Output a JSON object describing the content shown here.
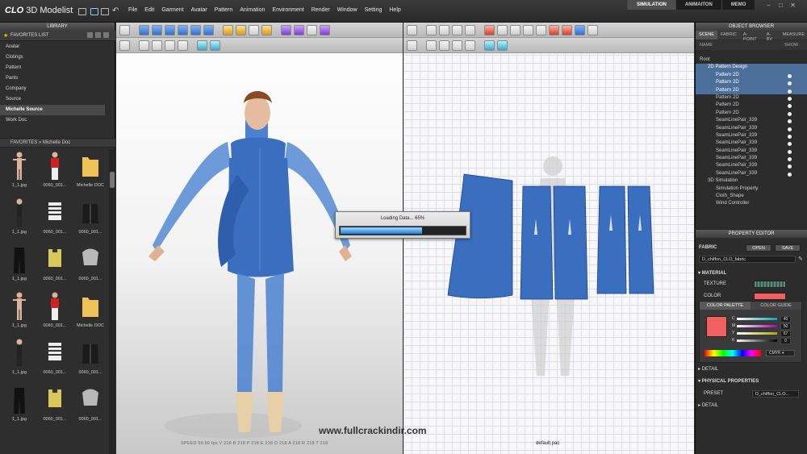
{
  "app": {
    "brand": "CLO",
    "name": "3D Modelist"
  },
  "menu": [
    "File",
    "Edit",
    "Garment",
    "Avatar",
    "Pattern",
    "Animation",
    "Environment",
    "Render",
    "Window",
    "Setting",
    "Help"
  ],
  "modes": [
    {
      "label": "SIMULATION",
      "active": true
    },
    {
      "label": "ANIMAITON",
      "active": false
    },
    {
      "label": "MEMO",
      "active": false
    }
  ],
  "library": {
    "title": "LIBRARY",
    "favorites_title": "FAVORITES LIST",
    "folders": [
      "Avatar",
      "Clotings",
      "Pattern",
      "Pants",
      "Company",
      "Source",
      "Michelle Source",
      "Work Doc"
    ],
    "selected_folder": "Michelle Source",
    "breadcrumb": "FAVORITES  »  Michelle Doc",
    "thumbnails": [
      {
        "caption": "1_1.jpg",
        "kind": "avatar"
      },
      {
        "caption": "0060_001...",
        "kind": "shirt-red"
      },
      {
        "caption": "Michelle DOC",
        "kind": "folder"
      },
      {
        "caption": "1_1.jpg",
        "kind": "avatar-dark"
      },
      {
        "caption": "0060_001...",
        "kind": "shirt-stripe"
      },
      {
        "caption": "0060_001...",
        "kind": "jacket"
      },
      {
        "caption": "1_1.jpg",
        "kind": "pants"
      },
      {
        "caption": "0060_001...",
        "kind": "shirt-yellow"
      },
      {
        "caption": "0060_001...",
        "kind": "armor"
      },
      {
        "caption": "1_1.jpg",
        "kind": "avatar"
      },
      {
        "caption": "0060_001...",
        "kind": "shirt-red"
      },
      {
        "caption": "Michelle DOC",
        "kind": "folder"
      },
      {
        "caption": "1_1.jpg",
        "kind": "avatar-dark"
      },
      {
        "caption": "0060_001...",
        "kind": "shirt-stripe"
      },
      {
        "caption": "0060_001...",
        "kind": "jacket"
      },
      {
        "caption": "1_1.jpg",
        "kind": "pants"
      },
      {
        "caption": "0060_001...",
        "kind": "shirt-yellow"
      },
      {
        "caption": "0060_001...",
        "kind": "armor"
      }
    ]
  },
  "viewport3d": {
    "status": "SPEED 59.60 fps   V 218   B 218   P 218   E 218   O 218   A 218   R 218   T 218"
  },
  "viewport2d": {
    "file_label": "default.pac"
  },
  "loading": {
    "text": "Loading Data... 65%",
    "progress": 0.65
  },
  "object_browser": {
    "title": "OBJECT BROWSER",
    "tabs": [
      {
        "label": "SCENE",
        "active": true
      },
      {
        "label": "FABRIC",
        "active": false
      },
      {
        "label": "A-POINT",
        "active": false
      },
      {
        "label": "A-BV",
        "active": false
      },
      {
        "label": "MEASURE",
        "active": false
      }
    ],
    "col_name": "NAME",
    "col_show": "SHOW",
    "tree": [
      {
        "label": "Root",
        "indent": 0,
        "highlight": false,
        "dot": false
      },
      {
        "label": "2D Pattern Design",
        "indent": 1,
        "highlight": true,
        "dot": false
      },
      {
        "label": "Pattern 2D",
        "indent": 2,
        "highlight": true,
        "dot": true
      },
      {
        "label": "Pattern 2D",
        "indent": 2,
        "highlight": true,
        "dot": true
      },
      {
        "label": "Pattern 2D",
        "indent": 2,
        "highlight": true,
        "dot": true
      },
      {
        "label": "Pattern 2D",
        "indent": 2,
        "highlight": false,
        "dot": true
      },
      {
        "label": "Pattern 2D",
        "indent": 2,
        "highlight": false,
        "dot": true
      },
      {
        "label": "Pattern 2D",
        "indent": 2,
        "highlight": false,
        "dot": true
      },
      {
        "label": "SeamLinePair_339",
        "indent": 2,
        "highlight": false,
        "dot": true
      },
      {
        "label": "SeamLinePair_339",
        "indent": 2,
        "highlight": false,
        "dot": true
      },
      {
        "label": "SeamLinePair_339",
        "indent": 2,
        "highlight": false,
        "dot": true
      },
      {
        "label": "SeamLinePair_339",
        "indent": 2,
        "highlight": false,
        "dot": true
      },
      {
        "label": "SeamLinePair_339",
        "indent": 2,
        "highlight": false,
        "dot": true
      },
      {
        "label": "SeamLinePair_339",
        "indent": 2,
        "highlight": false,
        "dot": true
      },
      {
        "label": "SeamLinePair_339",
        "indent": 2,
        "highlight": false,
        "dot": true
      },
      {
        "label": "SeamLinePair_339",
        "indent": 2,
        "highlight": false,
        "dot": true
      },
      {
        "label": "3D Simulation",
        "indent": 1,
        "highlight": false,
        "dot": false
      },
      {
        "label": "Simulation Property",
        "indent": 2,
        "highlight": false,
        "dot": false
      },
      {
        "label": "Cloth_Shape",
        "indent": 2,
        "highlight": false,
        "dot": false
      },
      {
        "label": "Wind Controller",
        "indent": 2,
        "highlight": false,
        "dot": false
      }
    ]
  },
  "property_editor": {
    "title": "PROPERTY EDITOR",
    "fabric_label": "FABRIC",
    "open_label": "OPEN",
    "save_label": "SAVE",
    "fabric_name": "D_chiffon_CLO_fabric",
    "material_label": "MATERIAL",
    "texture_label": "TEXTURE",
    "color_label": "COLOR",
    "color_hex": "#f46060",
    "palette_tabs": [
      {
        "label": "COLOR PALETTE",
        "active": true
      },
      {
        "label": "COLOR GUIDE",
        "active": false
      }
    ],
    "cmyk": [
      {
        "ch": "C",
        "val": "40"
      },
      {
        "ch": "M",
        "val": "50"
      },
      {
        "ch": "Y",
        "val": "67"
      },
      {
        "ch": "K",
        "val": "0"
      }
    ],
    "mode": "CMYK",
    "detail_label": "DETAIL",
    "physical_label": "PHYSICAL PROPERTIES",
    "preset_label": "PRESET",
    "preset_value": "D_chiffon_CLO...",
    "detail2_label": "DETAIL"
  },
  "watermark": "www.fullcrackindir.com",
  "colors": {
    "garment": "#3a6fc0",
    "accent": "#4c6f99"
  }
}
